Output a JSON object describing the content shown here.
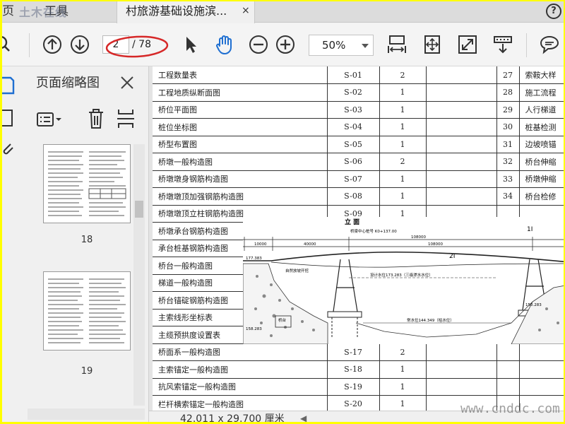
{
  "menu": {
    "home": "页",
    "tools": "工具"
  },
  "watermark_top": "土木在线",
  "document_tab": {
    "title": "村旅游基础设施滨...",
    "close": "×"
  },
  "help": {
    "label": "?"
  },
  "toolbar": {
    "page_current": "2",
    "page_total": "/ 78",
    "zoom": "50%",
    "icons": [
      "search-icon",
      "page-up-icon",
      "page-down-icon",
      "select-arrow-icon",
      "hand-tool-icon",
      "zoom-out-icon",
      "zoom-in-icon",
      "fit-width-icon",
      "fit-page-icon",
      "full-screen-icon",
      "scroll-mode-icon",
      "comment-icon"
    ],
    "annotation_color": "#d62828"
  },
  "thumbnail_pane": {
    "title": "页面缩略图",
    "close": "×",
    "pages": [
      {
        "number": "18"
      },
      {
        "number": "19"
      }
    ]
  },
  "document": {
    "rows": [
      {
        "name": "工程数量表",
        "code": "S-01",
        "count": "2",
        "rnum": "27",
        "rname": "索鞍大样"
      },
      {
        "name": "工程地质纵断面图",
        "code": "S-02",
        "count": "1",
        "rnum": "28",
        "rname": "施工流程"
      },
      {
        "name": "桥位平面图",
        "code": "S-03",
        "count": "1",
        "rnum": "29",
        "rname": "人行梯道"
      },
      {
        "name": "桩位坐标图",
        "code": "S-04",
        "count": "1",
        "rnum": "30",
        "rname": "桩基检测"
      },
      {
        "name": "桥型布置图",
        "code": "S-05",
        "count": "1",
        "rnum": "31",
        "rname": "边坡喷锚"
      },
      {
        "name": "桥墩一般构造图",
        "code": "S-06",
        "count": "2",
        "rnum": "32",
        "rname": "桥台伸缩"
      },
      {
        "name": "桥墩墩身钢筋构造图",
        "code": "S-07",
        "count": "1",
        "rnum": "33",
        "rname": "桥墩伸缩"
      },
      {
        "name": "桥墩墩顶加强钢筋构造图",
        "code": "S-08",
        "count": "1",
        "rnum": "34",
        "rname": "桥台检修"
      },
      {
        "name": "桥墩墩顶立柱钢筋构造图",
        "code": "S-09",
        "count": "1",
        "rnum": "",
        "rname": ""
      },
      {
        "name": "桥墩承台钢筋构造图",
        "code": "",
        "count": "",
        "rnum": "",
        "rname": ""
      },
      {
        "name": "承台桩基钢筋构造图",
        "code": "",
        "count": "",
        "rnum": "",
        "rname": ""
      },
      {
        "name": "桥台一般构造图",
        "code": "",
        "count": "",
        "rnum": "",
        "rname": ""
      },
      {
        "name": "梯道一般构造图",
        "code": "",
        "count": "",
        "rnum": "",
        "rname": ""
      },
      {
        "name": "桥台锚碇钢筋构造图",
        "code": "",
        "count": "",
        "rnum": "",
        "rname": ""
      },
      {
        "name": "主索线形坐标表",
        "code": "",
        "count": "",
        "rnum": "",
        "rname": ""
      },
      {
        "name": "主缆预拱度设置表",
        "code": "",
        "count": "",
        "rnum": "",
        "rname": ""
      },
      {
        "name": "桥面系一般构造图",
        "code": "S-17",
        "count": "2",
        "rnum": "",
        "rname": ""
      },
      {
        "name": "主索锚定一般构造图",
        "code": "S-18",
        "count": "1",
        "rnum": "",
        "rname": ""
      },
      {
        "name": "抗风索锚定一般构造图",
        "code": "S-19",
        "count": "1",
        "rnum": "",
        "rname": ""
      },
      {
        "name": "栏杆横索锚定一般构造图",
        "code": "S-20",
        "count": "1",
        "rnum": "",
        "rname": ""
      }
    ],
    "overlay_drawing": {
      "title": "立 面",
      "center_label": "桥梁中心桩号 K0+137.00",
      "total_span": "108000",
      "left_span": "40000",
      "left_offset": "10000",
      "design_level": "设计水位173.283（三级渗水水位）",
      "normal_level": "常水位144.349（枯水位）",
      "left_elev": "177.383",
      "left_foot_elev": "158.283",
      "right_elev": "150.283",
      "label_left_abutment": "桥台",
      "label_bank": "自然放坡开挖",
      "marks": [
        "2I",
        "1I",
        "1I",
        "0"
      ]
    }
  },
  "status": {
    "page_size": "42.011 x 29.700 厘米",
    "watermark": "www.cnddc.com"
  }
}
